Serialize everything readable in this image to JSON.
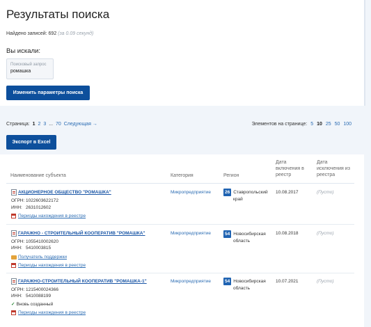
{
  "page": {
    "title": "Результаты поиска",
    "found_label": "Найдено записей: 692",
    "found_time": "(за 0.09 секунд)",
    "sought_label": "Вы искали:",
    "query_label": "Поисковый запрос",
    "query_value": "ромашка",
    "change_button": "Изменить параметры поиска",
    "excel_button": "Экспорт в Excel"
  },
  "pager": {
    "label": "Страница:",
    "pages": [
      "1",
      "2",
      "3",
      "...",
      "70"
    ],
    "current": "1",
    "next": "Следующая →"
  },
  "per_page": {
    "label": "Элементов на странице:",
    "options": [
      "5",
      "10",
      "25",
      "50",
      "100"
    ],
    "current": "10"
  },
  "table": {
    "headers": {
      "name": "Наименование субъекта",
      "category": "Категория",
      "region": "Регион",
      "included": "Дата включения в реестр",
      "excluded": "Дата исключения из реестра"
    },
    "rows": [
      {
        "name": "АКЦИОНЕРНОЕ ОБЩЕСТВО \"РОМАШКА\"",
        "ogrn_label": "ОГРН:",
        "ogrn": "1022603622172",
        "inn_label": "ИНН:",
        "inn": "2631012602",
        "period_link": "Периоды нахождения в реестре",
        "category": "Микропредприятие",
        "region_code": "26",
        "region_line1": "Ставропольский",
        "region_line2": "край",
        "included": "10.08.2017",
        "excluded": "(Пусто)"
      },
      {
        "name": "ГАРАЖНО - СТРОИТЕЛЬНЫЙ КООПЕРАТИВ \"РОМАШКА\"",
        "ogrn_label": "ОГРН:",
        "ogrn": "1055410002620",
        "inn_label": "ИНН:",
        "inn": "5410003815",
        "support_link": "Получатель поддержки",
        "period_link": "Периоды нахождения в реестре",
        "category": "Микропредприятие",
        "region_code": "54",
        "region_line1": "Новосибирская",
        "region_line2": "область",
        "included": "10.08.2018",
        "excluded": "(Пусто)"
      },
      {
        "name": "ГАРАЖНО-СТРОИТЕЛЬНЫЙ КООПЕРАТИВ \"РОМАШКА-1\"",
        "ogrn_label": "ОГРН:",
        "ogrn": "1215400024366",
        "inn_label": "ИНН:",
        "inn": "5410088199",
        "new_label": "Вновь созданный",
        "period_link": "Периоды нахождения в реестре",
        "category": "Микропредприятие",
        "region_code": "54",
        "region_line1": "Новосибирская",
        "region_line2": "область",
        "included": "10.07.2021",
        "excluded": "(Пусто)"
      }
    ]
  }
}
